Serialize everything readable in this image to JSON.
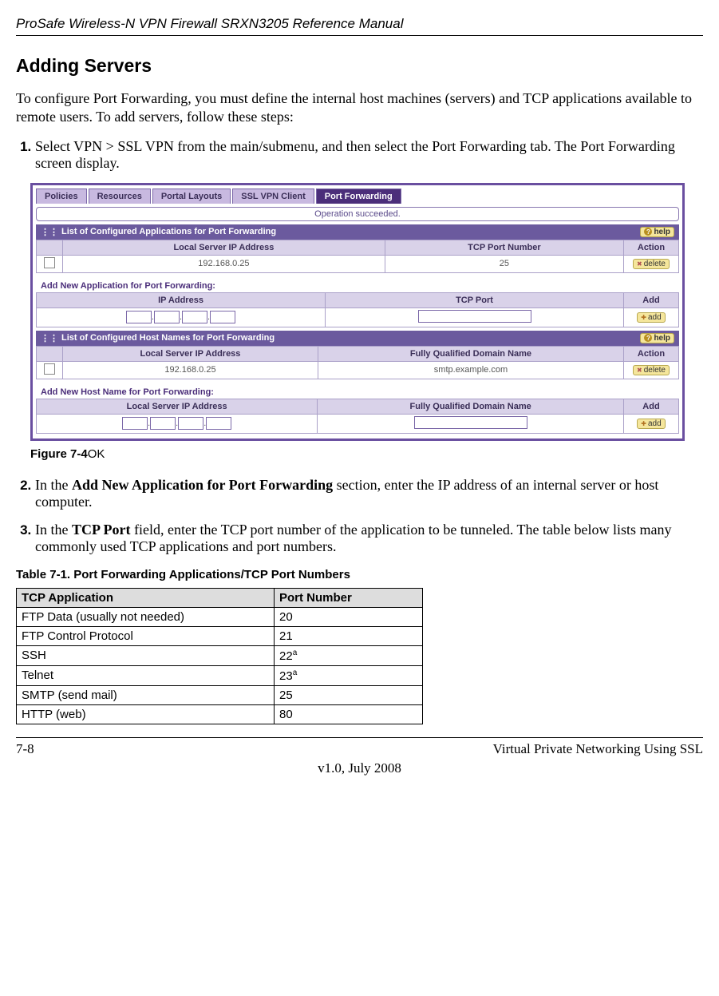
{
  "doc_title": "ProSafe Wireless-N VPN Firewall SRXN3205 Reference Manual",
  "section_heading": "Adding Servers",
  "intro": "To configure Port Forwarding, you must define the internal host machines (servers) and TCP applications available to remote users. To add servers, follow these steps:",
  "step1": "Select VPN > SSL VPN from the main/submenu, and then select the Port Forwarding tab. The Port Forwarding screen display.",
  "figure": {
    "tabs": [
      "Policies",
      "Resources",
      "Portal Layouts",
      "SSL VPN Client",
      "Port Forwarding"
    ],
    "operation": "Operation succeeded.",
    "panel1_title": "List of Configured Applications for Port Forwarding",
    "help_label": "help",
    "cols_apps": [
      "Local Server IP Address",
      "TCP Port Number",
      "Action"
    ],
    "apps_row": {
      "ip": "192.168.0.25",
      "port": "25"
    },
    "delete_label": "delete",
    "panel2_title": "Add New Application for Port Forwarding:",
    "cols_add_app": [
      "IP Address",
      "TCP Port",
      "Add"
    ],
    "add_label": "add",
    "panel3_title": "List of Configured Host Names for Port Forwarding",
    "cols_hosts": [
      "Local Server IP Address",
      "Fully Qualified Domain Name",
      "Action"
    ],
    "hosts_row": {
      "ip": "192.168.0.25",
      "fqdn": "smtp.example.com"
    },
    "panel4_title": "Add New Host Name for Port Forwarding:",
    "cols_add_host": [
      "Local Server IP Address",
      "Fully Qualified Domain Name",
      "Add"
    ]
  },
  "figcap": "Figure 7-4",
  "figcap_suffix": "OK",
  "step2_prefix": "In the ",
  "step2_bold": "Add New Application for Port Forwarding",
  "step2_suffix": " section, enter the IP address of an internal server or host computer.",
  "step3_prefix": "In the ",
  "step3_bold": "TCP Port",
  "step3_suffix": " field, enter the TCP port number of the application to be tunneled. The table below lists many commonly used TCP applications and port numbers.",
  "table_title": "Table 7-1.    Port Forwarding Applications/TCP Port Numbers",
  "table_headers": [
    "TCP Application",
    "Port Number"
  ],
  "chart_data": {
    "type": "table",
    "rows": [
      {
        "app": "FTP Data (usually not needed)",
        "port": "20",
        "note": ""
      },
      {
        "app": "FTP Control Protocol",
        "port": "21",
        "note": ""
      },
      {
        "app": "SSH",
        "port": "22",
        "note": "a"
      },
      {
        "app": "Telnet",
        "port": "23",
        "note": "a"
      },
      {
        "app": "SMTP (send mail)",
        "port": "25",
        "note": ""
      },
      {
        "app": "HTTP (web)",
        "port": "80",
        "note": ""
      }
    ]
  },
  "footer_left": "7-8",
  "footer_right": "Virtual Private Networking Using SSL",
  "footer_center": "v1.0, July 2008"
}
